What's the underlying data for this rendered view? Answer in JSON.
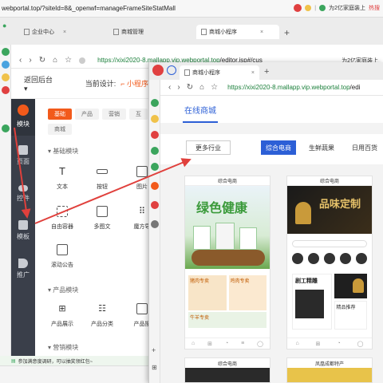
{
  "back_window": {
    "address_url": "webportal.top/?siteId=8&_openwf=manageFrameSiteStatMall",
    "promo_text": "为2亿家庭装上",
    "promo_badge": "热搜",
    "tabs": [
      {
        "label": "企业中心"
      },
      {
        "label": "商城管理"
      },
      {
        "label": "商城小程序"
      }
    ],
    "nav_url_host": "https://xixi2020-8.mallapp.vip.webportal.top",
    "nav_url_path": "/editor.jsp#/cus",
    "nav_promo": "为2亿家庭装上"
  },
  "editor": {
    "back_label": "返回后台",
    "back_arrow": "▾",
    "current_design_label": "当前设计:",
    "current_design_value": "小程序"
  },
  "dark_nav": {
    "items": [
      {
        "label": "模块"
      },
      {
        "label": "页面"
      },
      {
        "label": "控件"
      },
      {
        "label": "模板"
      },
      {
        "label": "推广"
      }
    ]
  },
  "component_panel": {
    "category_tabs": [
      "基础",
      "产品",
      "营销",
      "互"
    ],
    "category_tab_row2": "商城",
    "sections": {
      "basic": "基础模块",
      "product": "产品模块",
      "marketing": "营销模块"
    },
    "components": {
      "text": "文本",
      "button": "按钮",
      "image": "图片",
      "free_container": "自由容器",
      "multi_image": "多图文",
      "rubik": "魔方导",
      "scroll_notice": "滚动公告",
      "product_show": "产品展示",
      "product_category": "产品分类",
      "product_search": "产品搜"
    }
  },
  "status_bar": {
    "text": "参加满意度调研，可以抽奖领红包~"
  },
  "front_window": {
    "tab_label": "商城小程序",
    "nav_url_host": "https://xixi2020-8.mallapp.vip.webportal.top",
    "nav_url_path": "/edi",
    "page_title": "在线商城",
    "more_industry": "更多行业",
    "filters": [
      "综合电商",
      "生鲜蔬果",
      "日用百货"
    ],
    "cards": [
      {
        "header": "综合电商",
        "banner_title": "绿色健康",
        "promo_items": [
          "猪肉专卖",
          "鸡肉专卖",
          "牛羊专卖"
        ]
      },
      {
        "header": "综合电商",
        "banner_title": "品味定制",
        "section_title": "剧工精雕",
        "section_sub": "精品推荐"
      }
    ],
    "bottom_cards": [
      {
        "header": "综合电商"
      },
      {
        "header": "凤凰成都特产"
      }
    ]
  },
  "colors": {
    "accent_orange": "#f25a1b",
    "accent_blue": "#2c5fd6",
    "dark_nav_bg": "#3a3f4a",
    "arrow_red": "#e0403c"
  }
}
